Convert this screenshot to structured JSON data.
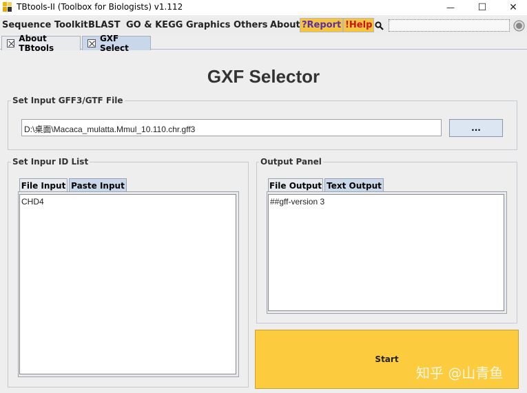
{
  "window": {
    "title": "TBtools-II (Toolbox for Biologists) v1.112",
    "minimize_glyph": "—",
    "maximize_glyph": "☐",
    "close_glyph": "✕"
  },
  "menu": {
    "items": [
      "Sequence Toolkit",
      "BLAST",
      "GO & KEGG",
      "Graphics",
      "Others",
      "About"
    ],
    "report": "?Report",
    "help": "!Help",
    "search_icon": "search-icon",
    "report_color": "#f5c542"
  },
  "doc_tabs": [
    {
      "label": "About TBtools"
    },
    {
      "label": "GXF Select"
    }
  ],
  "page": {
    "title": "GXF Selector"
  },
  "input_file": {
    "legend": "Set Input GFF3/GTF File",
    "value": "D:\\桌面\\Macaca_mulatta.Mmul_10.110.chr.gff3",
    "browse_label": "..."
  },
  "id_list": {
    "legend": "Set Inpur ID List",
    "tabs": [
      "File Input",
      "Paste Input"
    ],
    "content": "CHD4"
  },
  "output": {
    "legend": "Output Panel",
    "tabs": [
      "File Output",
      "Text Output"
    ],
    "content": "##gff-version 3"
  },
  "start_label": "Start",
  "watermark": "知乎 @山青鱼",
  "colors": {
    "start_button": "#fdcb3e",
    "active_tab": "#c9d7ea"
  }
}
